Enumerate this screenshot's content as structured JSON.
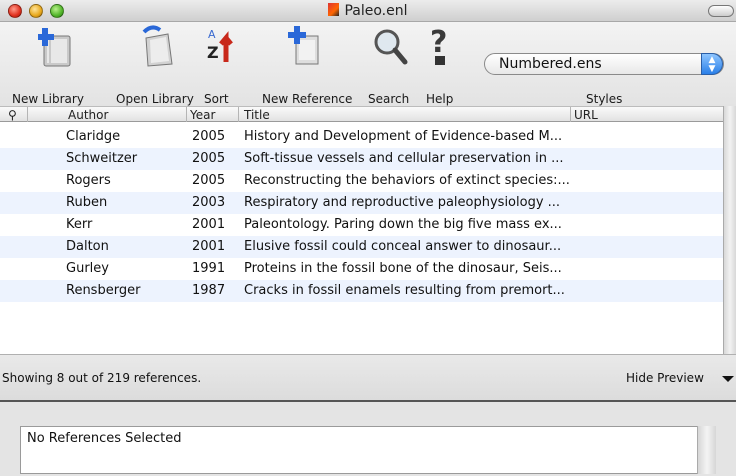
{
  "window": {
    "title": "Paleo.enl"
  },
  "toolbar": {
    "new_library": "New Library",
    "open_library": "Open Library",
    "sort": "Sort",
    "new_reference": "New Reference",
    "search": "Search",
    "help": "Help",
    "styles_label": "Styles",
    "style_value": "Numbered.ens"
  },
  "columns": {
    "attach": "",
    "author": "Author",
    "year": "Year",
    "title": "Title",
    "url": "URL"
  },
  "references": [
    {
      "author": "Claridge",
      "year": "2005",
      "title": "History and Development of Evidence-based M..."
    },
    {
      "author": "Schweitzer",
      "year": "2005",
      "title": "Soft-tissue vessels and cellular preservation in ..."
    },
    {
      "author": "Rogers",
      "year": "2005",
      "title": "Reconstructing the behaviors of extinct species:..."
    },
    {
      "author": "Ruben",
      "year": "2003",
      "title": "Respiratory and reproductive paleophysiology ..."
    },
    {
      "author": "Kerr",
      "year": "2001",
      "title": "Paleontology. Paring down the big five mass ex..."
    },
    {
      "author": "Dalton",
      "year": "2001",
      "title": "Elusive fossil could conceal answer to dinosaur..."
    },
    {
      "author": "Gurley",
      "year": "1991",
      "title": "Proteins in the fossil bone of the dinosaur, Seis..."
    },
    {
      "author": "Rensberger",
      "year": "1987",
      "title": "Cracks in fossil enamels resulting from premort..."
    }
  ],
  "status": {
    "count_text": "Showing 8 out of 219 references.",
    "hide_preview": "Hide Preview"
  },
  "preview": {
    "text": "No References Selected"
  }
}
